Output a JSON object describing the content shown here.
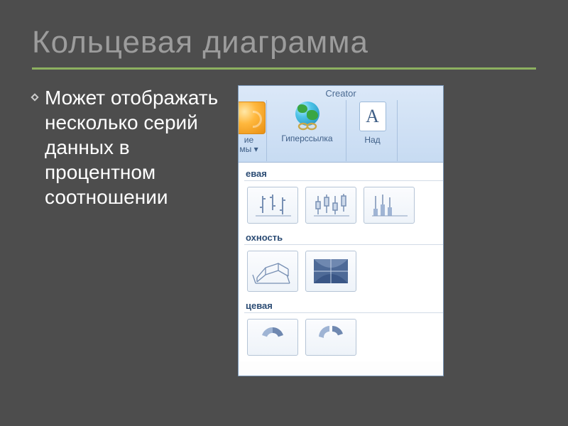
{
  "title": "Кольцевая диаграмма",
  "bullet": "Может отображать несколько серий данных в процентном соотношении",
  "ribbon": {
    "title": "Creator",
    "group1_line1": "ие",
    "group1_line2": "мы ▾",
    "hyperlink": "Гиперссылка",
    "text_btn": "Над",
    "text_glyph": "A"
  },
  "gallery": {
    "cat1": "евая",
    "cat2": "охность",
    "cat3": "цевая"
  }
}
